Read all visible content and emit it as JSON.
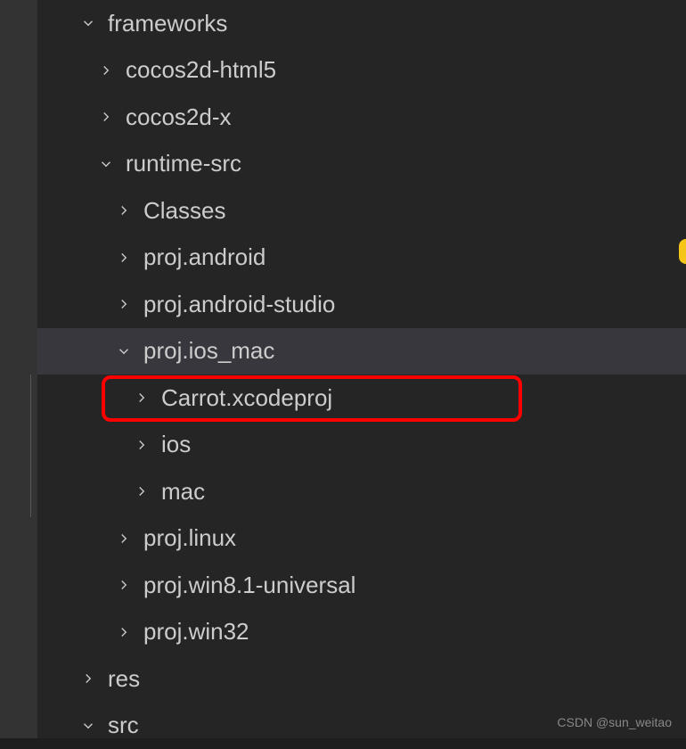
{
  "tree": {
    "frameworks": "frameworks",
    "cocos2d_html5": "cocos2d-html5",
    "cocos2d_x": "cocos2d-x",
    "runtime_src": "runtime-src",
    "classes": "Classes",
    "proj_android": "proj.android",
    "proj_android_studio": "proj.android-studio",
    "proj_ios_mac": "proj.ios_mac",
    "carrot_xcodeproj": "Carrot.xcodeproj",
    "ios": "ios",
    "mac": "mac",
    "proj_linux": "proj.linux",
    "proj_win81_universal": "proj.win8.1-universal",
    "proj_win32": "proj.win32",
    "res": "res",
    "src": "src"
  },
  "watermark": "CSDN @sun_weitao"
}
